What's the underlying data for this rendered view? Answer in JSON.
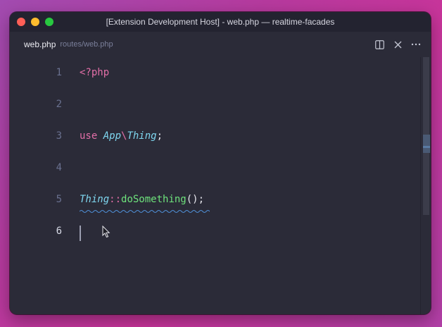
{
  "window": {
    "title": "[Extension Development Host] - web.php — realtime-facades"
  },
  "tab": {
    "name": "web.php",
    "path": "routes/web.php"
  },
  "icons": {
    "split": "split-editor-icon",
    "close": "close-icon",
    "more": "more-actions-icon"
  },
  "editor": {
    "active_line": 6,
    "lines": [
      {
        "number": "1",
        "tokens": [
          {
            "text": "<?php",
            "type": "kw"
          }
        ]
      },
      {
        "number": "2",
        "tokens": []
      },
      {
        "number": "3",
        "tokens": [
          {
            "text": "use ",
            "type": "kw"
          },
          {
            "text": "App",
            "type": "ns"
          },
          {
            "text": "\\",
            "type": "op"
          },
          {
            "text": "Thing",
            "type": "ns"
          },
          {
            "text": ";",
            "type": "punc"
          }
        ]
      },
      {
        "number": "4",
        "tokens": []
      },
      {
        "number": "5",
        "tokens": [
          {
            "text": "Thing",
            "type": "ns"
          },
          {
            "text": "::",
            "type": "op"
          },
          {
            "text": "doSomething",
            "type": "fn"
          },
          {
            "text": "();",
            "type": "punc"
          }
        ]
      },
      {
        "number": "6",
        "tokens": []
      }
    ]
  },
  "colors": {
    "keyword": "#e36fa8",
    "namespace": "#7fd7f0",
    "function": "#6ee37c",
    "background": "#2b2b38",
    "squiggle": "#4f8fd6"
  }
}
